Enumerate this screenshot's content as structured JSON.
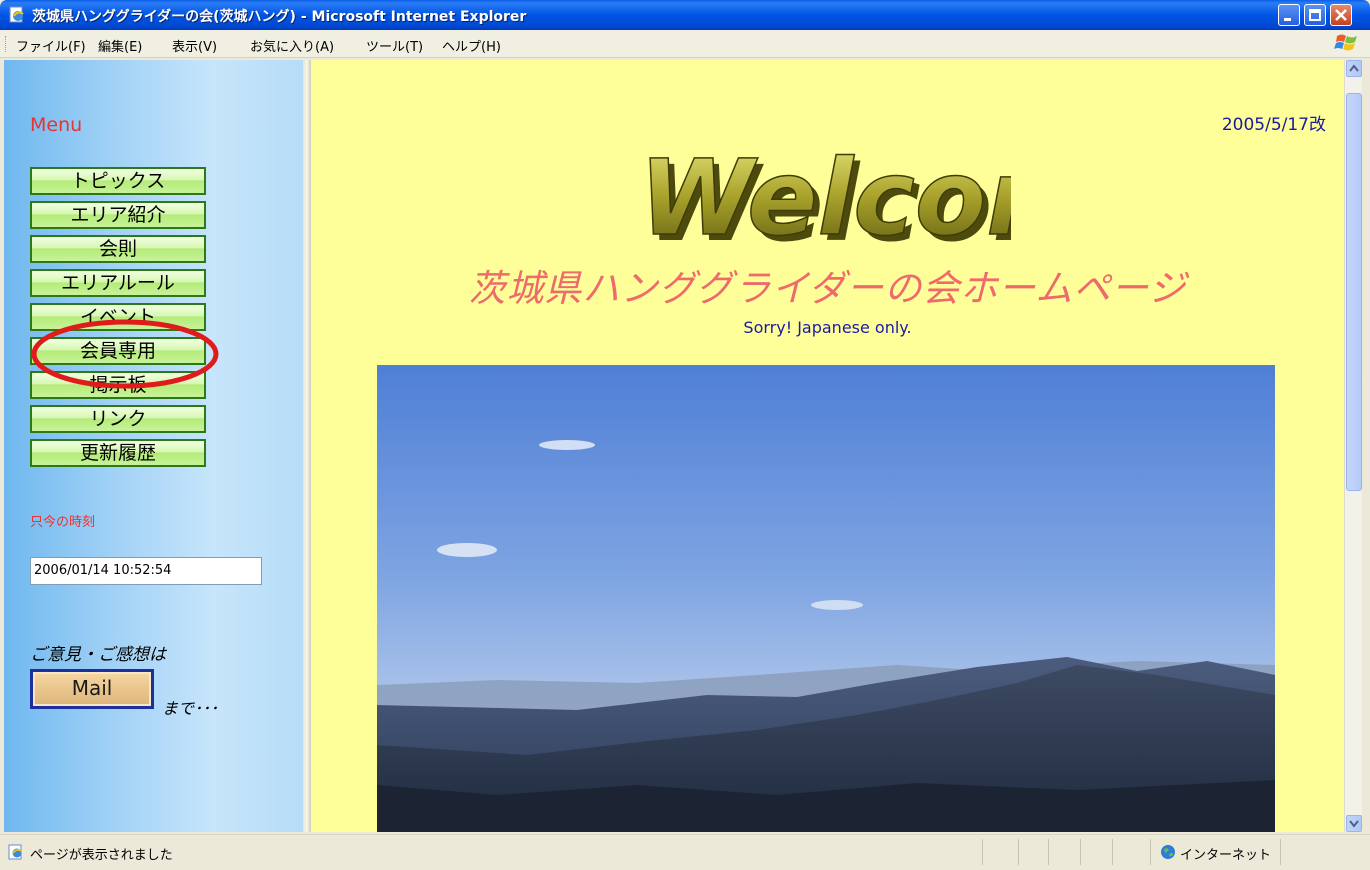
{
  "window": {
    "title": "茨城県ハンググライダーの会(茨城ハング) - Microsoft Internet Explorer"
  },
  "menubar": {
    "items": [
      "ファイル(F)",
      "編集(E)",
      "表示(V)",
      "お気に入り(A)",
      "ツール(T)",
      "ヘルプ(H)"
    ]
  },
  "sidebar": {
    "menu_title": "Menu",
    "items": [
      "トピックス",
      "エリア紹介",
      "会則",
      "エリアルール",
      "イベント",
      "会員専用",
      "掲示板",
      "リンク",
      "更新履歴"
    ],
    "highlighted_item": "会員専用",
    "clock_label": "只今の時刻",
    "clock_value": "2006/01/14 10:52:54",
    "feedback_text": "ご意見・ご感想は",
    "mail_button": "Mail",
    "made_text": "まで･･･"
  },
  "main": {
    "date": "2005/5/17改",
    "welcome_text": "Welcome",
    "site_title": "茨城県ハンググライダーの会ホームページ",
    "subtitle": "Sorry! Japanese only."
  },
  "statusbar": {
    "status_text": "ページが表示されました",
    "zone_text": "インターネット"
  },
  "colors": {
    "accent_red": "#e83333",
    "page_background": "#ffff99",
    "title_pink": "#ef6b6b",
    "subtitle_blue": "#1a1aa8",
    "nav_button_border": "#2c7a17"
  }
}
